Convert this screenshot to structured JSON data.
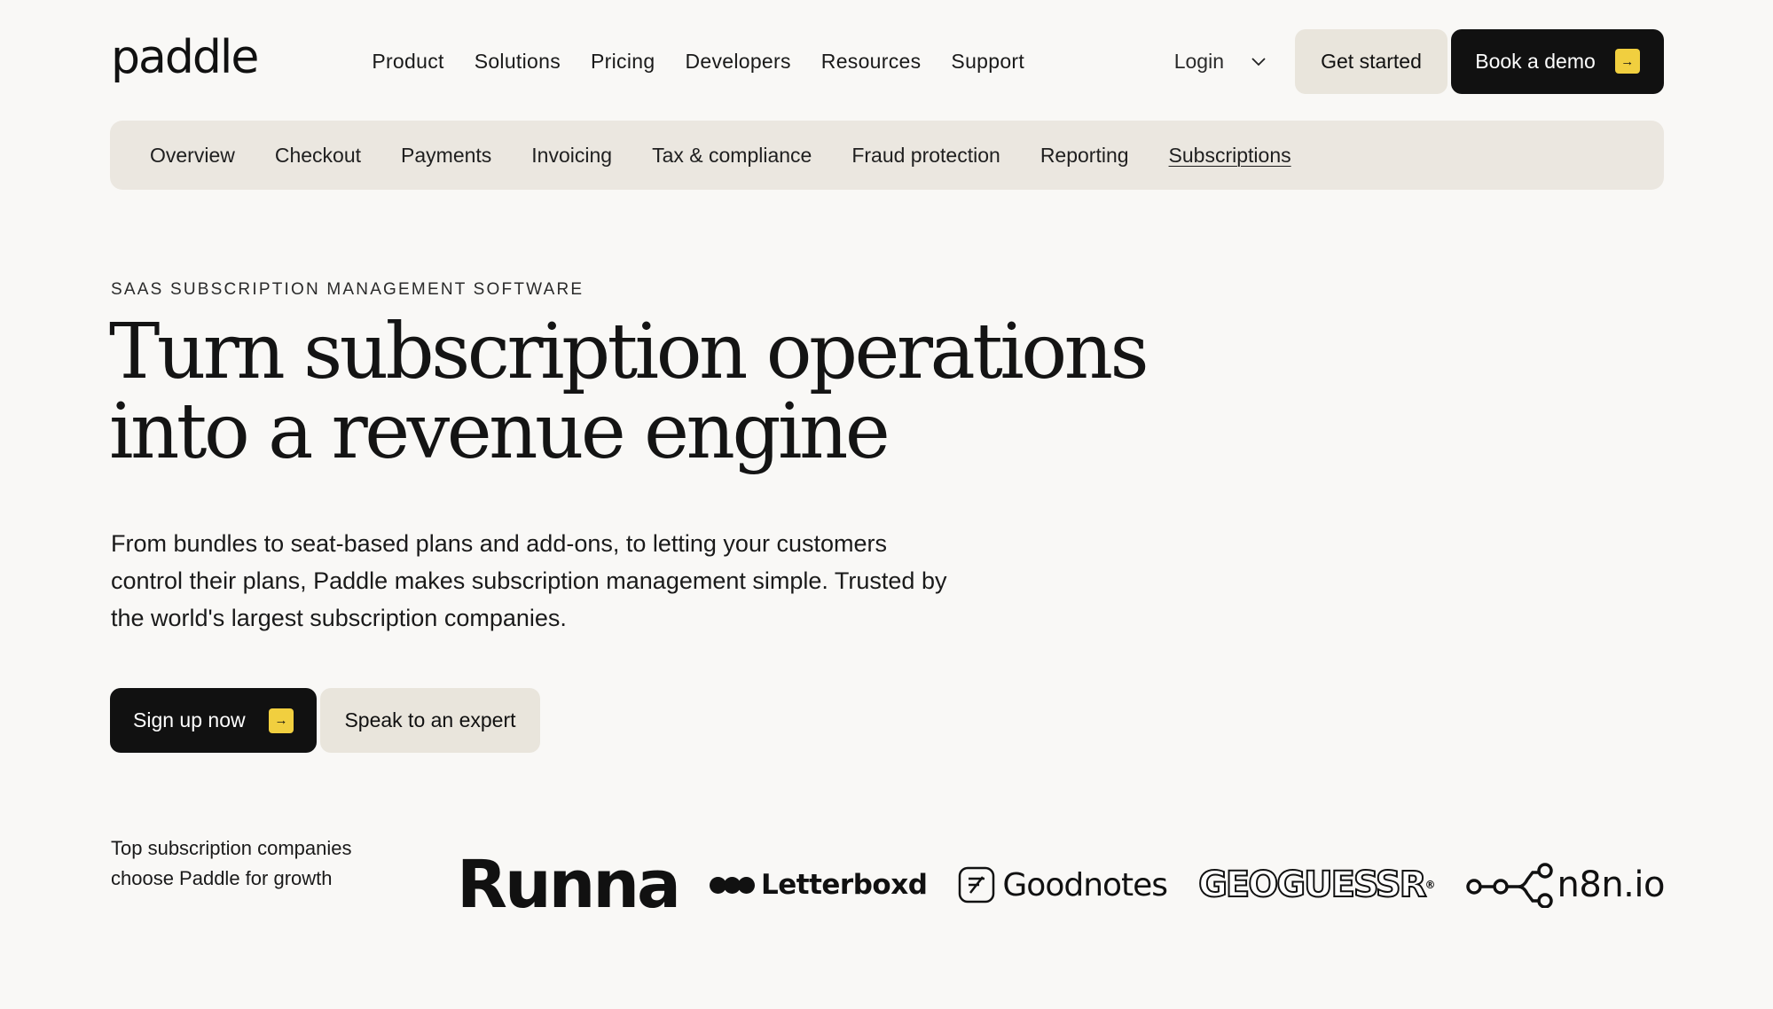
{
  "brand": {
    "logo_text": "paddle"
  },
  "nav": {
    "items": [
      "Product",
      "Solutions",
      "Pricing",
      "Developers",
      "Resources",
      "Support"
    ],
    "login_label": "Login",
    "get_started_label": "Get started",
    "book_demo_label": "Book a demo"
  },
  "subnav": {
    "items": [
      "Overview",
      "Checkout",
      "Payments",
      "Invoicing",
      "Tax & compliance",
      "Fraud protection",
      "Reporting",
      "Subscriptions"
    ],
    "active": "Subscriptions"
  },
  "hero": {
    "eyebrow": "SAAS SUBSCRIPTION MANAGEMENT SOFTWARE",
    "headline_line1": "Turn subscription operations",
    "headline_line2": "into a revenue engine",
    "lead": "From bundles to seat-based plans and add-ons, to letting your customers control their plans, Paddle makes subscription management simple. Trusted by the world's largest subscription companies.",
    "primary_cta": "Sign up now",
    "secondary_cta": "Speak to an expert"
  },
  "customers": {
    "caption": "Top subscription companies choose Paddle for growth",
    "logos": [
      "Runna",
      "Letterboxd",
      "Goodnotes",
      "GEOGUESSR",
      "n8n.io"
    ]
  },
  "colors": {
    "background": "#f9f8f6",
    "accent_yellow": "#f1cf3f",
    "dark": "#111111",
    "light_button": "#e9e5dc",
    "subnav_bg": "#ebe7e0"
  },
  "icons": {
    "chevron": "chevron-down-icon",
    "arrow": "arrow-right-icon"
  }
}
